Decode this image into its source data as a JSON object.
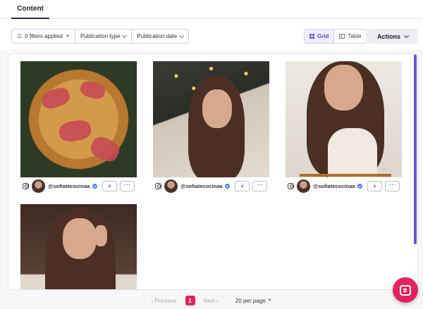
{
  "tabs": [
    {
      "label": "Content",
      "active": true
    }
  ],
  "filters": {
    "applied_label": "0 filters applied",
    "publication_type": "Publication type",
    "publication_date": "Publication date"
  },
  "view": {
    "grid_label": "Grid",
    "table_label": "Table",
    "active": "grid"
  },
  "actions_label": "Actions",
  "cards": [
    {
      "network_icon": "instagram-icon",
      "handle": "@sofiatecocinaa",
      "verified": true,
      "thumbnail": "food-tart"
    },
    {
      "network_icon": "instagram-icon",
      "handle": "@sofiatecocinaa",
      "verified": true,
      "thumbnail": "woman-portrait"
    },
    {
      "network_icon": "instagram-icon",
      "handle": "@sofiatecocinaa",
      "verified": true,
      "thumbnail": "woman-laughing"
    },
    {
      "network_icon": "instagram-icon",
      "handle": "",
      "verified": false,
      "thumbnail": "woman-winking"
    }
  ],
  "pagination": {
    "previous": "Previous",
    "current": "1",
    "next": "Next",
    "per_page": "20 per page"
  },
  "colors": {
    "accent": "#5b4bd8",
    "brand": "#e0245e"
  }
}
